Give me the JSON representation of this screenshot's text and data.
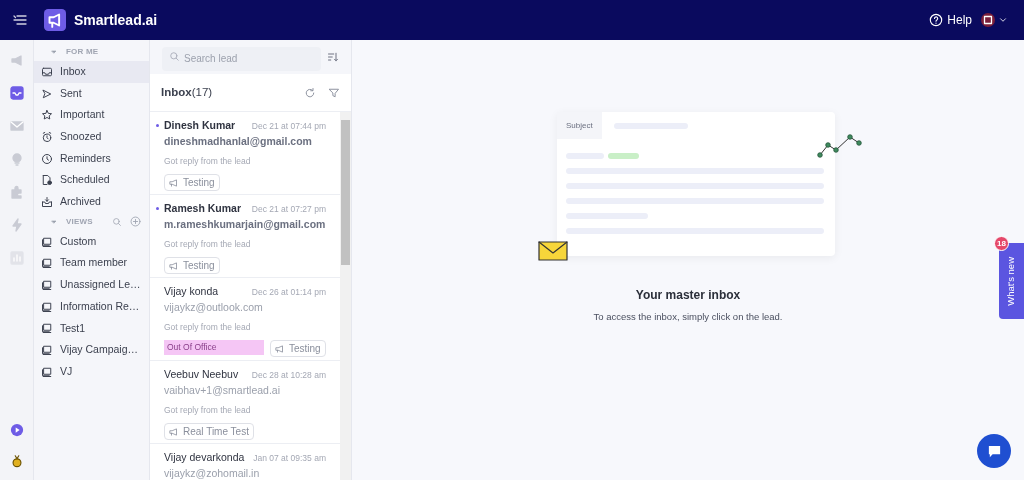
{
  "top_bar": {
    "brand": "Smartlead.ai",
    "help": "Help"
  },
  "rail": [
    {
      "kind": "megaphone",
      "selected": false
    },
    {
      "kind": "inbox",
      "selected": true
    },
    {
      "kind": "mail",
      "selected": false
    },
    {
      "kind": "bulb",
      "selected": false
    },
    {
      "kind": "puzzle",
      "selected": false
    },
    {
      "kind": "bolt",
      "selected": false
    },
    {
      "kind": "chart",
      "selected": false
    }
  ],
  "sidebar": {
    "sections": [
      {
        "title": "FOR ME",
        "expanded": true,
        "items": [
          {
            "label": "Inbox",
            "selected": true
          },
          {
            "label": "Sent",
            "selected": false
          },
          {
            "label": "Important",
            "selected": false
          },
          {
            "label": "Snoozed",
            "selected": false
          },
          {
            "label": "Reminders",
            "selected": false
          },
          {
            "label": "Scheduled",
            "selected": false
          },
          {
            "label": "Archived",
            "selected": false
          }
        ]
      },
      {
        "title": "VIEWS",
        "expanded": true,
        "items": [
          {
            "label": "Custom",
            "selected": false
          },
          {
            "label": "Team member",
            "selected": false
          },
          {
            "label": "Unassigned Le…",
            "selected": false
          },
          {
            "label": "Information Re…",
            "selected": false
          },
          {
            "label": "Test1",
            "selected": false
          },
          {
            "label": "Vijay Campaig…",
            "selected": false
          },
          {
            "label": "VJ",
            "selected": false
          }
        ]
      }
    ]
  },
  "lead_list": {
    "search_placeholder": "Search lead",
    "title": "Inbox",
    "count": "(17)",
    "leads": [
      {
        "name": "Dinesh Kumar",
        "unread": true,
        "date": "Dec 21 at 07:44 pm",
        "email": "dineshmadhanlal@gmail.com",
        "snippet": "Got reply from the lead",
        "tags": [
          {
            "kind": "campaign",
            "text": "Testing"
          }
        ]
      },
      {
        "name": "Ramesh Kumar",
        "unread": true,
        "date": "Dec 21 at 07:27 pm",
        "email": "m.rameshkumarjain@gmail.com",
        "snippet": "Got reply from the lead",
        "tags": [
          {
            "kind": "campaign",
            "text": "Testing"
          }
        ]
      },
      {
        "name": "Vijay konda",
        "unread": false,
        "date": "Dec 26 at 01:14 pm",
        "email": "vijaykz@outlook.com",
        "snippet": "Got reply from the lead",
        "tags": [
          {
            "kind": "category",
            "text": "Out Of Office",
            "color": "#f5c6f5"
          },
          {
            "kind": "campaign",
            "text": "Testing"
          }
        ]
      },
      {
        "name": "Veebuv Neebuv",
        "unread": false,
        "date": "Dec 28 at 10:28 am",
        "email": "vaibhav+1@smartlead.ai",
        "snippet": "Got reply from the lead",
        "tags": [
          {
            "kind": "campaign",
            "text": "Real Time Test"
          }
        ]
      },
      {
        "name": "Vijay devarkonda",
        "unread": false,
        "date": "Jan 07 at 09:35 am",
        "email": "vijaykz@zohomail.in"
      }
    ]
  },
  "main": {
    "card_subject": "Subject",
    "title": "Your master inbox",
    "subtitle": "To access the inbox, simply click on the lead."
  },
  "whats_new": {
    "label": "What's new",
    "badge": "18"
  }
}
